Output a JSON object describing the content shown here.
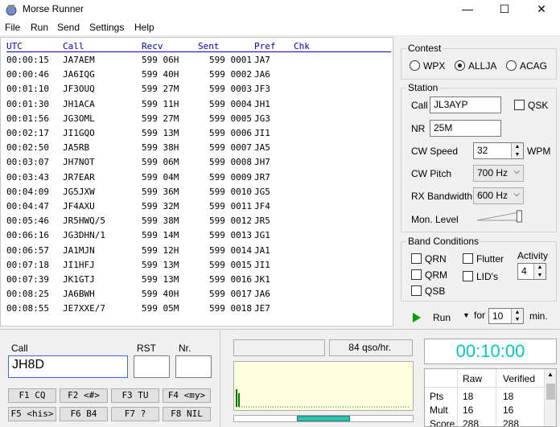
{
  "window": {
    "title": "Morse Runner",
    "minimize": "—",
    "maximize": "☐",
    "close": "✕"
  },
  "menu": [
    "File",
    "Run",
    "Send",
    "Settings",
    "Help"
  ],
  "log": {
    "headers": [
      "UTC",
      "Call",
      "Recv",
      "Sent",
      "Pref",
      "Chk"
    ],
    "rows": [
      [
        "00:00:15",
        "JA7AEM",
        "599 06H",
        "599 0001",
        "JA7"
      ],
      [
        "00:00:46",
        "JA6IQG",
        "599 40H",
        "599 0002",
        "JA6"
      ],
      [
        "00:01:10",
        "JF3OUQ",
        "599 27M",
        "599 0003",
        "JF3"
      ],
      [
        "00:01:30",
        "JH1ACA",
        "599 11H",
        "599 0004",
        "JH1"
      ],
      [
        "00:01:56",
        "JG3OML",
        "599 27M",
        "599 0005",
        "JG3"
      ],
      [
        "00:02:17",
        "JI1GQO",
        "599 13M",
        "599 0006",
        "JI1"
      ],
      [
        "00:02:50",
        "JA5RB",
        "599 38H",
        "599 0007",
        "JA5"
      ],
      [
        "00:03:07",
        "JH7NOT",
        "599 06M",
        "599 0008",
        "JH7"
      ],
      [
        "00:03:43",
        "JR7EAR",
        "599 04M",
        "599 0009",
        "JR7"
      ],
      [
        "00:04:09",
        "JG5JXW",
        "599 36M",
        "599 0010",
        "JG5"
      ],
      [
        "00:04:47",
        "JF4AXU",
        "599 32M",
        "599 0011",
        "JF4"
      ],
      [
        "00:05:46",
        "JR5HWQ/5",
        "599 38M",
        "599 0012",
        "JR5"
      ],
      [
        "00:06:16",
        "JG3DHN/1",
        "599 14M",
        "599 0013",
        "JG1"
      ],
      [
        "00:06:57",
        "JA1MJN",
        "599 12H",
        "599 0014",
        "JA1"
      ],
      [
        "00:07:18",
        "JI1HFJ",
        "599 13M",
        "599 0015",
        "JI1"
      ],
      [
        "00:07:39",
        "JK1GTJ",
        "599 13M",
        "599 0016",
        "JK1"
      ],
      [
        "00:08:25",
        "JA6BWH",
        "599 40H",
        "599 0017",
        "JA6"
      ],
      [
        "00:08:55",
        "JE7XXE/7",
        "599 05M",
        "599 0018",
        "JE7"
      ]
    ]
  },
  "contest": {
    "title": "Contest",
    "options": [
      "WPX",
      "ALLJA",
      "ACAG"
    ],
    "selected": "ALLJA"
  },
  "station": {
    "title": "Station",
    "call_label": "Call",
    "call_value": "JL3AYP",
    "qsk_label": "QSK",
    "nr_label": "NR",
    "nr_value": "25M",
    "cw_speed_label": "CW Speed",
    "cw_speed_value": "32",
    "wpm_label": "WPM",
    "cw_pitch_label": "CW Pitch",
    "cw_pitch_value": "700 Hz",
    "rx_bw_label": "RX Bandwidth",
    "rx_bw_value": "600 Hz",
    "mon_level_label": "Mon. Level",
    "mon_level_fraction": 0.95
  },
  "band": {
    "title": "Band Conditions",
    "qrn": "QRN",
    "qrm": "QRM",
    "qsb": "QSB",
    "flutter": "Flutter",
    "lids": "LID's",
    "activity_label": "Activity",
    "activity_value": "4"
  },
  "run": {
    "run_label": "Run",
    "for_label": "for",
    "minutes_value": "10",
    "min_label": "min."
  },
  "entry": {
    "call_label": "Call",
    "call_value": "JH8D",
    "rst_label": "RST",
    "nr_label": "Nr.",
    "fkeys": [
      "F1 CQ",
      "F2 <#>",
      "F3 TU",
      "F4 <my>",
      "F5 <his>",
      "F6 B4",
      "F7 ?",
      "F8 NIL"
    ]
  },
  "status": {
    "rate": "84 qso/hr.",
    "timer": "00:10:00"
  },
  "score": {
    "headers": [
      "",
      "Raw",
      "Verified"
    ],
    "rows": [
      [
        "Pts",
        "18",
        "18"
      ],
      [
        "Mult",
        "16",
        "16"
      ],
      [
        "Score",
        "288",
        "288"
      ]
    ]
  },
  "colors": {
    "timer": "#00c8c8",
    "header": "#0000c8",
    "run_arrow": "#00a000"
  }
}
